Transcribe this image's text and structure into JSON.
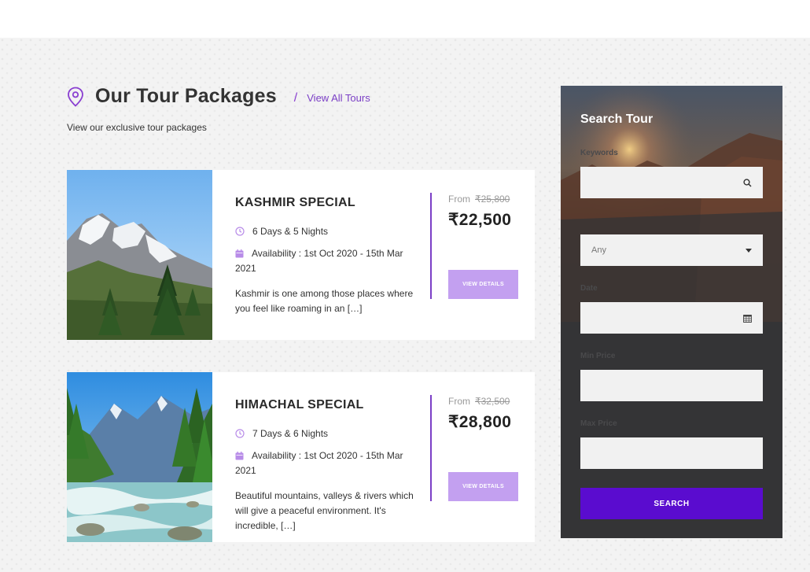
{
  "header": {
    "title": "Our Tour Packages",
    "separator": "/",
    "view_all_label": "View All Tours",
    "subtitle": "View our exclusive tour packages"
  },
  "packages": [
    {
      "title": "KASHMIR SPECIAL",
      "duration": "6 Days & 5 Nights",
      "availability": "Availability : 1st Oct 2020 - 15th Mar 2021",
      "description": "Kashmir is one among those places where you feel like roaming in an […]",
      "from_label": "From",
      "old_price": "₹25,800",
      "price": "₹22,500",
      "button_label": "VIEW DETAILS",
      "image": "snowy-mountain-pine-trees"
    },
    {
      "title": "HIMACHAL SPECIAL",
      "duration": "7 Days & 6 Nights",
      "availability": "Availability : 1st Oct 2020 - 15th Mar 2021",
      "description": "Beautiful mountains, valleys & rivers which will give a peaceful environment. It's incredible, […]",
      "from_label": "From",
      "old_price": "₹32,500",
      "price": "₹28,800",
      "button_label": "VIEW DETAILS",
      "image": "river-valley-pine-forest"
    }
  ],
  "search": {
    "title": "Search Tour",
    "keywords_label": "Keywords",
    "category_value": "Any",
    "date_label": "Date",
    "min_price_label": "Min Price",
    "max_price_label": "Max Price",
    "button_label": "SEARCH"
  },
  "icons": {
    "location": "location-pin-icon",
    "clock": "clock-icon",
    "calendar": "calendar-icon",
    "search": "search-icon",
    "dropdown": "caret-down-icon",
    "date": "calendar-grid-icon"
  },
  "colors": {
    "accent": "#7b3fc6",
    "button_light": "#c3a0f0",
    "search_button": "#5a0ccf",
    "sidebar_bg": "#343436"
  }
}
